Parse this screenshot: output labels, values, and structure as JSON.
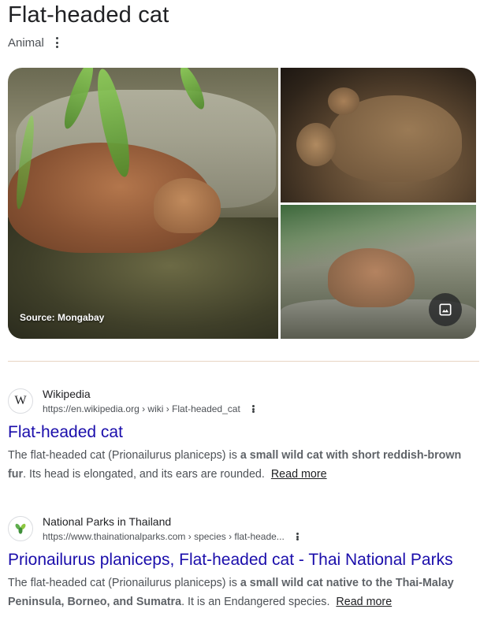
{
  "header": {
    "title": "Flat-headed cat",
    "subtitle": "Animal"
  },
  "gallery": {
    "source_caption": "Source: Mongabay",
    "images_button_icon": "image-icon"
  },
  "results": [
    {
      "favicon_letter": "W",
      "source_name": "Wikipedia",
      "url": "https://en.wikipedia.org › wiki › Flat-headed_cat",
      "title": "Flat-headed cat",
      "snippet_pre": "The flat-headed cat (Prionailurus planiceps) is ",
      "snippet_bold": "a small wild cat with short reddish-brown fur",
      "snippet_post": ". Its head is elongated, and its ears are rounded.",
      "read_more": "Read more"
    },
    {
      "favicon_icon": "leaf-icon",
      "source_name": "National Parks in Thailand",
      "url": "https://www.thainationalparks.com › species › flat-heade...",
      "title": "Prionailurus planiceps, Flat-headed cat - Thai National Parks",
      "snippet_pre": "The flat-headed cat (Prionailurus planiceps) is ",
      "snippet_bold": "a small wild cat native to the Thai-Malay Peninsula, Borneo, and Sumatra",
      "snippet_post": ". It is an Endangered species.",
      "read_more": "Read more"
    }
  ],
  "colors": {
    "link": "#1a0dab",
    "text": "#202124",
    "muted": "#4d5156"
  }
}
